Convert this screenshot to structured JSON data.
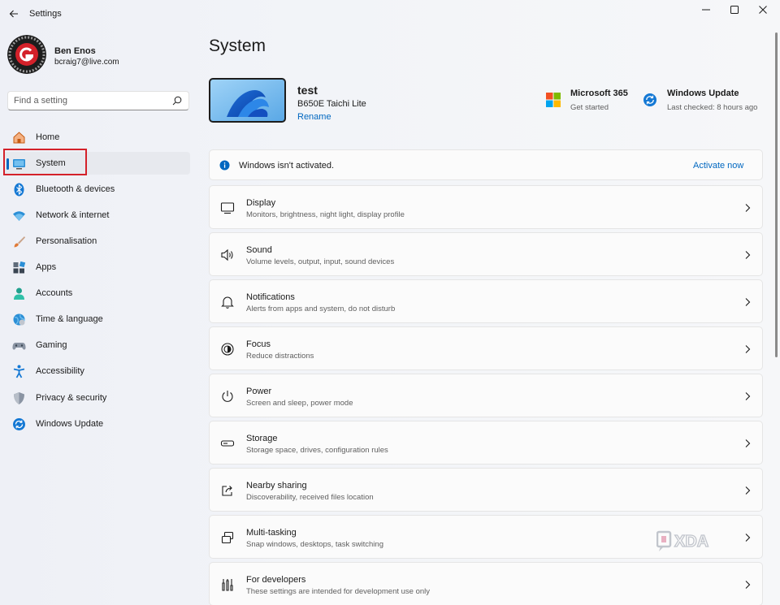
{
  "window": {
    "title": "Settings"
  },
  "profile": {
    "name": "Ben Enos",
    "email": "bcraig7@live.com"
  },
  "search": {
    "placeholder": "Find a setting"
  },
  "sidebar": {
    "items": [
      {
        "label": "Home",
        "icon": "home-icon"
      },
      {
        "label": "System",
        "icon": "system-icon",
        "active": true
      },
      {
        "label": "Bluetooth & devices",
        "icon": "bluetooth-icon"
      },
      {
        "label": "Network & internet",
        "icon": "wifi-icon"
      },
      {
        "label": "Personalisation",
        "icon": "brush-icon"
      },
      {
        "label": "Apps",
        "icon": "apps-icon"
      },
      {
        "label": "Accounts",
        "icon": "accounts-icon"
      },
      {
        "label": "Time & language",
        "icon": "globe-icon"
      },
      {
        "label": "Gaming",
        "icon": "gamepad-icon"
      },
      {
        "label": "Accessibility",
        "icon": "accessibility-icon"
      },
      {
        "label": "Privacy & security",
        "icon": "shield-icon"
      },
      {
        "label": "Windows Update",
        "icon": "update-icon"
      }
    ]
  },
  "main": {
    "title": "System",
    "device": {
      "name": "test",
      "model": "B650E Taichi Lite",
      "rename": "Rename"
    },
    "quick_links": [
      {
        "title": "Microsoft 365",
        "sub": "Get started",
        "icon": "microsoft-365-icon"
      },
      {
        "title": "Windows Update",
        "sub": "Last checked: 8 hours ago",
        "icon": "update-icon"
      }
    ],
    "activation": {
      "text": "Windows isn't activated.",
      "action": "Activate now"
    },
    "settings": [
      {
        "title": "Display",
        "sub": "Monitors, brightness, night light, display profile",
        "icon": "display-icon"
      },
      {
        "title": "Sound",
        "sub": "Volume levels, output, input, sound devices",
        "icon": "sound-icon"
      },
      {
        "title": "Notifications",
        "sub": "Alerts from apps and system, do not disturb",
        "icon": "bell-icon"
      },
      {
        "title": "Focus",
        "sub": "Reduce distractions",
        "icon": "focus-icon"
      },
      {
        "title": "Power",
        "sub": "Screen and sleep, power mode",
        "icon": "power-icon"
      },
      {
        "title": "Storage",
        "sub": "Storage space, drives, configuration rules",
        "icon": "storage-icon"
      },
      {
        "title": "Nearby sharing",
        "sub": "Discoverability, received files location",
        "icon": "share-icon"
      },
      {
        "title": "Multi-tasking",
        "sub": "Snap windows, desktops, task switching",
        "icon": "multitask-icon"
      },
      {
        "title": "For developers",
        "sub": "These settings are intended for development use only",
        "icon": "developer-icon"
      }
    ]
  },
  "colors": {
    "accent": "#0067c0",
    "highlight": "#d4212a"
  },
  "watermark": "XDA"
}
